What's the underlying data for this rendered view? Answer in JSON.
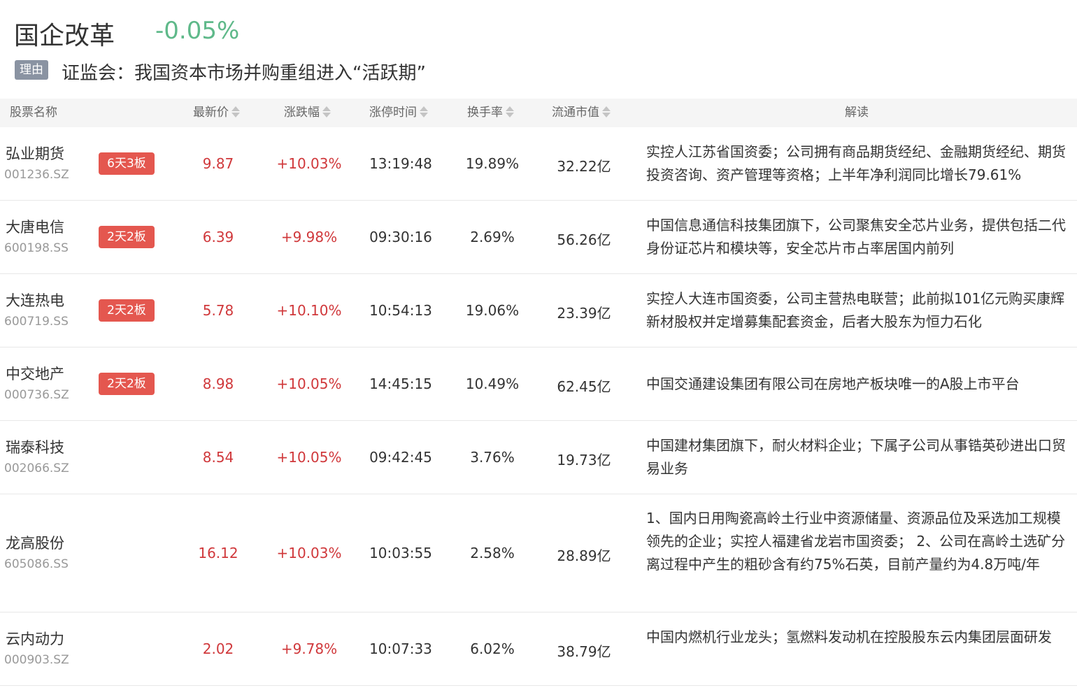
{
  "header": {
    "sector_name": "国企改革",
    "sector_change": "-0.05%",
    "reason_label": "理由",
    "reason_text": "证监会：我国资本市场并购重组进入“活跃期”"
  },
  "table": {
    "columns": [
      "股票名称",
      "最新价",
      "涨跌幅",
      "涨停时间",
      "换手率",
      "流通市值",
      "解读"
    ],
    "rows": [
      {
        "name": "弘业期货",
        "code": "001236.SZ",
        "badge": "6天3板",
        "price": "9.87",
        "change": "+10.03%",
        "time": "13:19:48",
        "turnover": "19.89%",
        "market_cap": "32.22亿",
        "desc": "实控人江苏省国资委；公司拥有商品期货经纪、金融期货经纪、期货投资咨询、资产管理等资格；上半年净利润同比增长79.61%"
      },
      {
        "name": "大唐电信",
        "code": "600198.SS",
        "badge": "2天2板",
        "price": "6.39",
        "change": "+9.98%",
        "time": "09:30:16",
        "turnover": "2.69%",
        "market_cap": "56.26亿",
        "desc": "中国信息通信科技集团旗下，公司聚焦安全芯片业务，提供包括二代身份证芯片和模块等，安全芯片市占率居国内前列"
      },
      {
        "name": "大连热电",
        "code": "600719.SS",
        "badge": "2天2板",
        "price": "5.78",
        "change": "+10.10%",
        "time": "10:54:13",
        "turnover": "19.06%",
        "market_cap": "23.39亿",
        "desc": "实控人大连市国资委，公司主营热电联营；此前拟101亿元购买康辉新材股权并定增募集配套资金，后者大股东为恒力石化"
      },
      {
        "name": "中交地产",
        "code": "000736.SZ",
        "badge": "2天2板",
        "price": "8.98",
        "change": "+10.05%",
        "time": "14:45:15",
        "turnover": "10.49%",
        "market_cap": "62.45亿",
        "desc": "中国交通建设集团有限公司在房地产板块唯一的A股上市平台"
      },
      {
        "name": "瑞泰科技",
        "code": "002066.SZ",
        "badge": "",
        "price": "8.54",
        "change": "+10.05%",
        "time": "09:42:45",
        "turnover": "3.76%",
        "market_cap": "19.73亿",
        "desc": "中国建材集团旗下，耐火材料企业；下属子公司从事锆英砂进出口贸易业务"
      },
      {
        "name": "龙高股份",
        "code": "605086.SS",
        "badge": "",
        "price": "16.12",
        "change": "+10.03%",
        "time": "10:03:55",
        "turnover": "2.58%",
        "market_cap": "28.89亿",
        "desc": "1、国内日用陶瓷高岭土行业中资源储量、资源品位及采选加工规模领先的企业；实控人福建省龙岩市国资委； 2、公司在高岭土选矿分离过程中产生的粗砂含有约75%石英，目前产量约为4.8万吨/年"
      },
      {
        "name": "云内动力",
        "code": "000903.SZ",
        "badge": "",
        "price": "2.02",
        "change": "+9.78%",
        "time": "10:07:33",
        "turnover": "6.02%",
        "market_cap": "38.79亿",
        "desc": "中国内燃机行业龙头；氢燃料发动机在控股股东云内集团层面研发"
      }
    ]
  },
  "colors": {
    "up": "#d0383b",
    "down": "#5fb98a",
    "badge": "#e4574f",
    "reason_badge": "#8a93a2"
  }
}
